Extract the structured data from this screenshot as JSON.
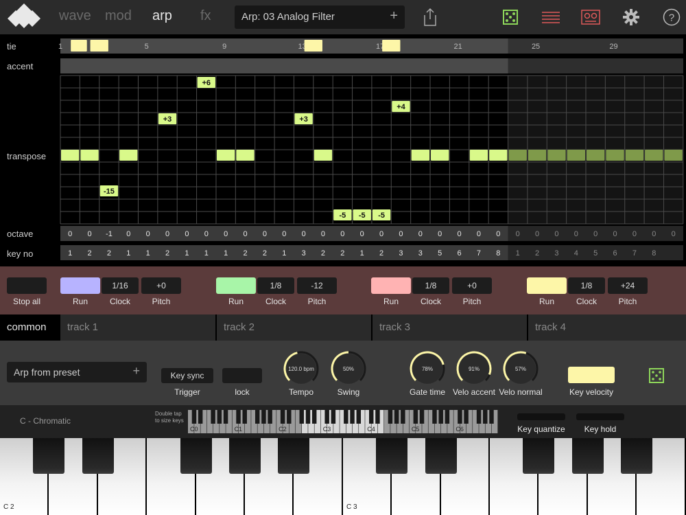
{
  "nav": {
    "tabs": [
      {
        "label": "wave"
      },
      {
        "label": "mod"
      },
      {
        "label": "arp"
      },
      {
        "label": "fx"
      }
    ],
    "active_tab": "arp",
    "preset": {
      "name": "Arp: 03 Analog Filter",
      "plus": "+"
    }
  },
  "grid": {
    "labels": {
      "tie": "tie",
      "accent": "accent",
      "transpose": "transpose",
      "octave": "octave",
      "key_no": "key no"
    },
    "step_numbers": [
      "1",
      "5",
      "9",
      "13",
      "17",
      "21",
      "25",
      "29"
    ],
    "transpose_labels": [
      "+6",
      "+3",
      "+3",
      "+4",
      "-15",
      "-5",
      "-5",
      "-5"
    ],
    "octave": [
      "0",
      "0",
      "-1",
      "0",
      "0",
      "0",
      "0",
      "0",
      "0",
      "0",
      "0",
      "0",
      "0",
      "0",
      "0",
      "0",
      "0",
      "0",
      "0",
      "0",
      "0",
      "0",
      "0",
      "0",
      "0",
      "0",
      "0",
      "0",
      "0",
      "0",
      "0",
      "0"
    ],
    "key_no": [
      "1",
      "2",
      "2",
      "1",
      "1",
      "2",
      "1",
      "1",
      "1",
      "2",
      "2",
      "1",
      "3",
      "2",
      "2",
      "1",
      "2",
      "3",
      "3",
      "5",
      "6",
      "7",
      "8",
      "1",
      "2",
      "3",
      "4",
      "5",
      "6",
      "7",
      "8"
    ]
  },
  "tracks_ctrl": {
    "stop_all": "Stop all",
    "run": "Run",
    "clock": "Clock",
    "pitch": "Pitch",
    "tracks": [
      {
        "clock": "1/16",
        "pitch": "+0",
        "color": "#b7b3ff"
      },
      {
        "clock": "1/8",
        "pitch": "-12",
        "color": "#a8f5a8"
      },
      {
        "clock": "1/8",
        "pitch": "+0",
        "color": "#ffb3b3"
      },
      {
        "clock": "1/8",
        "pitch": "+24",
        "color": "#fdf6a8"
      }
    ]
  },
  "track_tabs": [
    "common",
    "track 1",
    "track 2",
    "track 3",
    "track 4"
  ],
  "common": {
    "arp_from_preset": "Arp from preset",
    "plus": "+",
    "key_sync": "Key sync",
    "trigger": "Trigger",
    "lock": "lock",
    "knobs": [
      {
        "value": "120.0 bpm",
        "label": "Tempo",
        "level": 0.45
      },
      {
        "value": "50%",
        "label": "Swing",
        "level": 0.5
      },
      {
        "value": "78%",
        "label": "Gate time",
        "level": 0.78
      },
      {
        "value": "91%",
        "label": "Velo accent",
        "level": 0.91
      },
      {
        "value": "57%",
        "label": "Velo normal",
        "level": 0.57
      }
    ],
    "key_velocity": "Key velocity"
  },
  "keyboard": {
    "scale": "C - Chromatic",
    "hint_line1": "Double tap",
    "hint_line2": "to size keys",
    "octaves": [
      "C0",
      "C1",
      "C2",
      "C3",
      "C4",
      "C5",
      "C6"
    ],
    "key_quantize": "Key quantize",
    "key_hold": "Key hold",
    "c2": "C 2",
    "c3": "C 3"
  },
  "colors": {
    "accent_green": "#d9f98a",
    "tie_yellow": "#fdf6a8",
    "dim_green": "#7f9a4a",
    "red_icon": "#e05a5a"
  }
}
